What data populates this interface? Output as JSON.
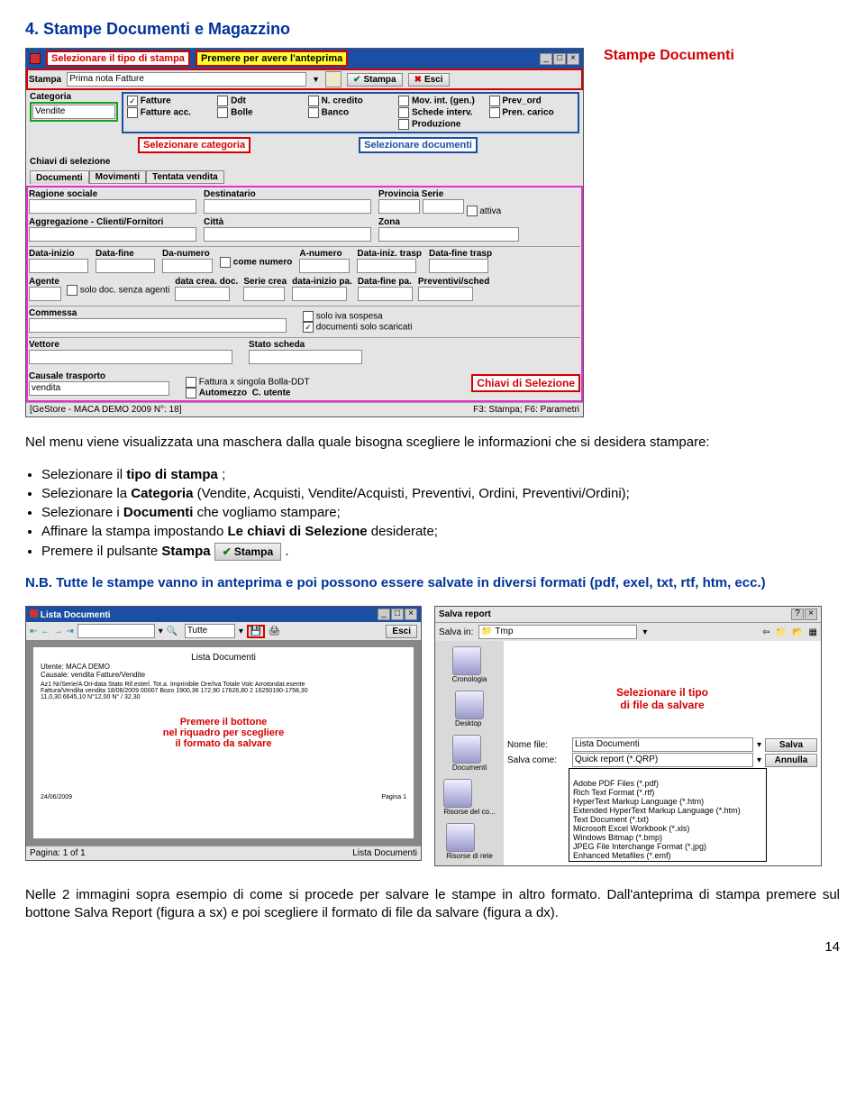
{
  "section": {
    "number_title": "4.  Stampe Documenti e Magazzino",
    "aside": "Stampe Documenti"
  },
  "ss1": {
    "title_left": "Selezionare il tipo di stampa",
    "title_mid": "Premere per avere l'anteprima",
    "toolbar": {
      "stampa_lbl": "Stampa",
      "stampa_field": "Prima nota Fatture",
      "btn_stampa": "Stampa",
      "btn_esci": "Esci"
    },
    "cat": {
      "lbl": "Categoria",
      "value": "Vendite",
      "cb_fatture": "Fatture",
      "cb_fattacc": "Fatture acc.",
      "cb_ddt": "Ddt",
      "cb_bolle": "Bolle",
      "cb_ncredito": "N. credito",
      "cb_banco": "Banco",
      "cb_movint": "Mov. int. (gen.)",
      "cb_schede": "Schede interv.",
      "cb_produz": "Produzione",
      "cb_prevord": "Prev_ord",
      "cb_pren": "Pren. carico",
      "hint_cat": "Selezionare categoria",
      "hint_doc": "Selezionare documenti"
    },
    "chiavi_hdr": "Chiavi di selezione",
    "tabs": {
      "t1": "Documenti",
      "t2": "Movimenti",
      "t3": "Tentata vendita"
    },
    "fields": {
      "ragione": "Ragione sociale",
      "dest": "Destinatario",
      "provserie": "Provincia Serie",
      "attiva": "attiva",
      "aggreg": "Aggregazione - Clienti/Fornitori",
      "citta": "Città",
      "zona": "Zona",
      "dinizio": "Data-inizio",
      "dfine": "Data-fine",
      "danum": "Da-numero",
      "comenum": "come numero",
      "anum": "A-numero",
      "diniztrasp": "Data-iniz. trasp",
      "dfinetrasp": "Data-fine trasp",
      "agente": "Agente",
      "soloagenti": "solo doc. senza agenti",
      "datacrea": "data crea. doc.",
      "seriecrea": "Serie crea",
      "diniziopa": "data-inizio pa.",
      "dfinepa": "Data-fine pa.",
      "prevsched": "Preventivi/sched",
      "commessa": "Commessa",
      "soloiva": "solo iva sospesa",
      "docscar": "documenti solo scaricati",
      "vettore": "Vettore",
      "statoscheda": "Stato scheda",
      "fattsing": "Fattura x singola Bolla-DDT",
      "automezzo": "Automezzo",
      "cutente": "C. utente",
      "caustrasp": "Causale trasporto",
      "caustrasp_val": "vendita",
      "chiavibox": "Chiavi di Selezione"
    },
    "status": {
      "left": "[GeStore - MACA DEMO 2009 N°: 18]",
      "right": "F3: Stampa; F6: Parametri"
    }
  },
  "intro": "Nel menu viene visualizzata una maschera dalla quale bisogna scegliere le informazioni che si desidera stampare:",
  "bullets": {
    "b1_pre": "Selezionare il ",
    "b1_b": "tipo di stampa",
    "b1_post": " ;",
    "b2_pre": "Selezionare la ",
    "b2_b": "Categoria",
    "b2_post": " (Vendite, Acquisti, Vendite/Acquisti, Preventivi, Ordini, Preventivi/Ordini);",
    "b3_pre": "Selezionare i ",
    "b3_b": "Documenti",
    "b3_post": " che vogliamo stampare;",
    "b4_pre": "Affinare la stampa impostando ",
    "b4_b": "Le chiavi di Selezione",
    "b4_post": " desiderate;",
    "b5_pre": "Premere il pulsante ",
    "b5_b": "Stampa",
    "b5_btn": "Stampa",
    "b5_post": " ."
  },
  "nb": {
    "label": "N.B.",
    "text": " Tutte le stampe vanno in anteprima e poi possono essere salvate in diversi formati (pdf, exel, txt, rtf, htm, ecc.)"
  },
  "ss2a": {
    "title": "Lista Documenti",
    "combo": "Tutte",
    "esci": "Esci",
    "doc_title": "Lista Documenti",
    "meta1": "Utente: MACA DEMO",
    "meta2": "Causale: vendita   Fatture/Vendite",
    "cols": "Az1 Nr/Serie/A    Ori-data    Stato    Rif.esterl.   Tot.a.    Imprinibile   Ore/Iva    Totale     Volc   Arrotondat.esente",
    "row1": "Fattura/Vendita   vendita    18/06/2009   00007   Bozo   1900,36    172,90    17626,80    2   16250190-1758,30",
    "row2": "                                                  11,0,30    6645,10     N°12,00           N° / 32,30",
    "hint": "Premere il bottone\nnel riquadro per scegliere\nil formato da salvare",
    "date": "24/06/2009",
    "pagina": "Pagina 1",
    "status_l": "Pagina: 1 of 1",
    "status_r": "Lista Documenti"
  },
  "ss2b": {
    "title": "Salva report",
    "salvain": "Salva in:",
    "folder": "Tmp",
    "side": {
      "s1": "Cronologia",
      "s2": "Desktop",
      "s3": "Documenti",
      "s4": "Risorse del co...",
      "s5": "Risorse di rete"
    },
    "hint": "Selezionare il tipo\ndi file da salvare",
    "nomefile_lbl": "Nome file:",
    "nomefile_val": "Lista Documenti",
    "salvacome_lbl": "Salva come:",
    "salvacome_val": "Quick report (*.QRP)",
    "btn_salva": "Salva",
    "btn_annulla": "Annulla",
    "types": {
      "t0": "Quick report (*.QRP)",
      "t1": "Adobe PDF Files (*.pdf)",
      "t2": "Rich Text Format (*.rtf)",
      "t3": "HyperText Markup Language (*.htm)",
      "t4": "Extended HyperText Markup Language (*.htm)",
      "t5": "Text Document (*.txt)",
      "t6": "Microsoft Excel Workbook (*.xls)",
      "t7": "Windows Bitmap (*.bmp)",
      "t8": "JPEG File Interchange Format (*.jpg)",
      "t9": "Enhanced Metafiles (*.emf)"
    }
  },
  "closing": "Nelle 2 immagini sopra esempio di come si procede per salvare le stampe in altro formato. Dall'anteprima di stampa premere sul bottone Salva Report (figura a sx) e poi scegliere il formato di file da salvare (figura a dx).",
  "pagenum": "14"
}
